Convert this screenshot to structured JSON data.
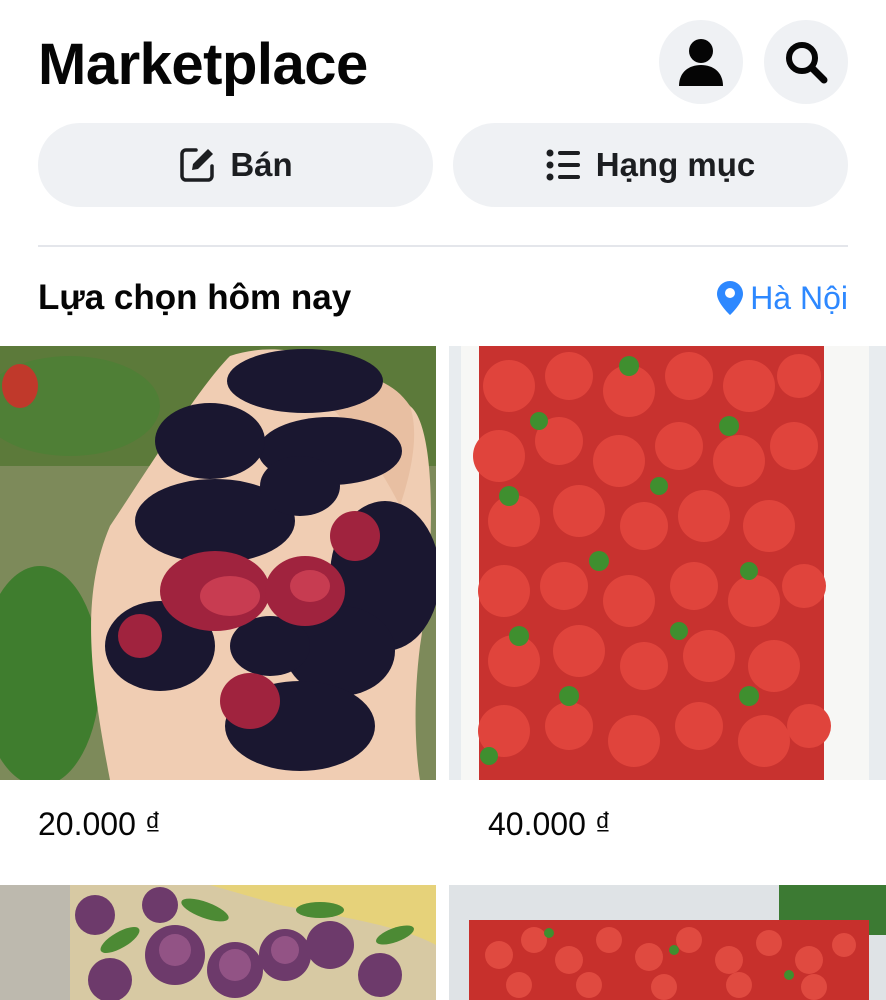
{
  "header": {
    "title": "Marketplace",
    "profile_icon": "person-icon",
    "search_icon": "search-icon"
  },
  "actions": {
    "sell_label": "Bán",
    "sell_icon": "edit-square-icon",
    "categories_label": "Hạng mục",
    "categories_icon": "list-icon"
  },
  "section": {
    "title": "Lựa chọn hôm nay",
    "location": "Hà Nội",
    "location_icon": "map-pin-icon"
  },
  "listings": [
    {
      "price": "20.000 ₫",
      "image": "mulberries-photo"
    },
    {
      "price": "40.000 ₫",
      "image": "strawberries-box-photo"
    },
    {
      "price": "",
      "image": "plums-photo"
    },
    {
      "price": "",
      "image": "strawberries-tray-photo"
    }
  ],
  "colors": {
    "accent": "#2d88ff",
    "button_bg": "#eff1f4",
    "text": "#050505"
  }
}
